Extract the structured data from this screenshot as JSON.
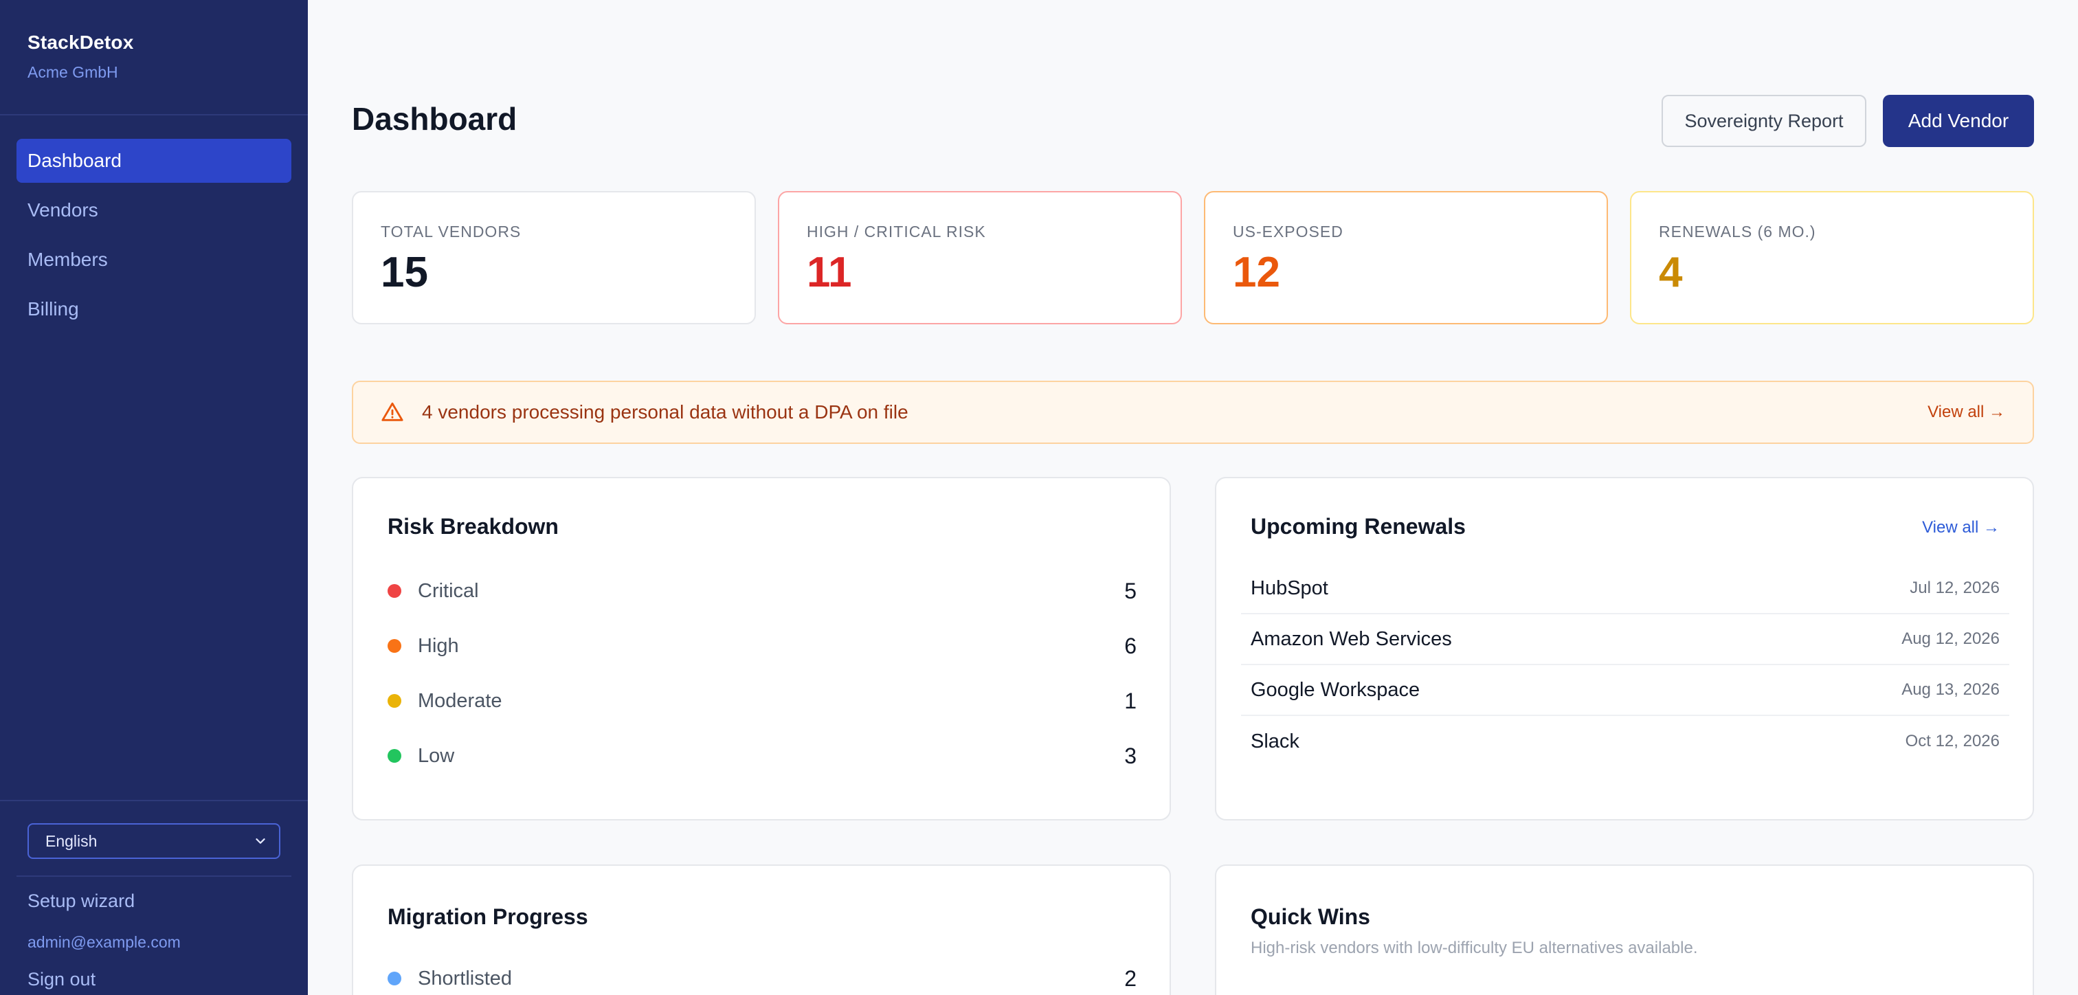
{
  "sidebar": {
    "brand": "StackDetox",
    "org": "Acme GmbH",
    "nav": [
      {
        "label": "Dashboard",
        "active": true
      },
      {
        "label": "Vendors",
        "active": false
      },
      {
        "label": "Members",
        "active": false
      },
      {
        "label": "Billing",
        "active": false
      }
    ],
    "language": "English",
    "setup": "Setup wizard",
    "email": "admin@example.com",
    "signout": "Sign out"
  },
  "header": {
    "title": "Dashboard",
    "report_button": "Sovereignty Report",
    "add_button": "Add Vendor"
  },
  "stats": [
    {
      "label": "TOTAL VENDORS",
      "value": "15",
      "color": "#111827",
      "border": "#e5e7eb"
    },
    {
      "label": "HIGH / CRITICAL RISK",
      "value": "11",
      "color": "#dc2626",
      "border": "#fca5a5"
    },
    {
      "label": "US-EXPOSED",
      "value": "12",
      "color": "#ea580c",
      "border": "#fdba74"
    },
    {
      "label": "RENEWALS (6 MO.)",
      "value": "4",
      "color": "#ca8a04",
      "border": "#fde68a"
    }
  ],
  "alert": {
    "icon": "warning-triangle-icon",
    "text": "4 vendors processing personal data without a DPA on file",
    "link": "View all →"
  },
  "risk_breakdown": {
    "title": "Risk Breakdown",
    "items": [
      {
        "label": "Critical",
        "value": "5",
        "color": "#ef4444"
      },
      {
        "label": "High",
        "value": "6",
        "color": "#f97316"
      },
      {
        "label": "Moderate",
        "value": "1",
        "color": "#eab308"
      },
      {
        "label": "Low",
        "value": "3",
        "color": "#22c55e"
      }
    ]
  },
  "renewals": {
    "title": "Upcoming Renewals",
    "link": "View all →",
    "items": [
      {
        "name": "HubSpot",
        "date": "Jul 12, 2026"
      },
      {
        "name": "Amazon Web Services",
        "date": "Aug 12, 2026"
      },
      {
        "name": "Google Workspace",
        "date": "Aug 13, 2026"
      },
      {
        "name": "Slack",
        "date": "Oct 12, 2026"
      }
    ]
  },
  "migration": {
    "title": "Migration Progress",
    "items": [
      {
        "label": "Shortlisted",
        "value": "2",
        "color": "#60a5fa"
      }
    ]
  },
  "quick_wins": {
    "title": "Quick Wins",
    "subtitle": "High-risk vendors with low-difficulty EU alternatives available."
  }
}
